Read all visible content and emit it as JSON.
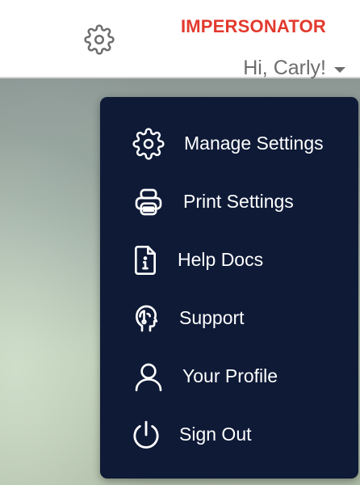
{
  "header": {
    "settings_icon": "gear-icon",
    "impersonator_label": "IMPERSONATOR",
    "impersonator_color": "#e23a2e",
    "greeting": "Hi, Carly!",
    "greeting_caret_icon": "caret-down-icon"
  },
  "menu": {
    "background_color": "#0e1a36",
    "items": [
      {
        "label": "Manage Settings",
        "icon": "gear-icon"
      },
      {
        "label": "Print Settings",
        "icon": "printer-icon"
      },
      {
        "label": "Help Docs",
        "icon": "info-document-icon"
      },
      {
        "label": "Support",
        "icon": "support-head-icon"
      },
      {
        "label": "Your Profile",
        "icon": "user-icon"
      },
      {
        "label": "Sign Out",
        "icon": "power-icon"
      }
    ]
  }
}
